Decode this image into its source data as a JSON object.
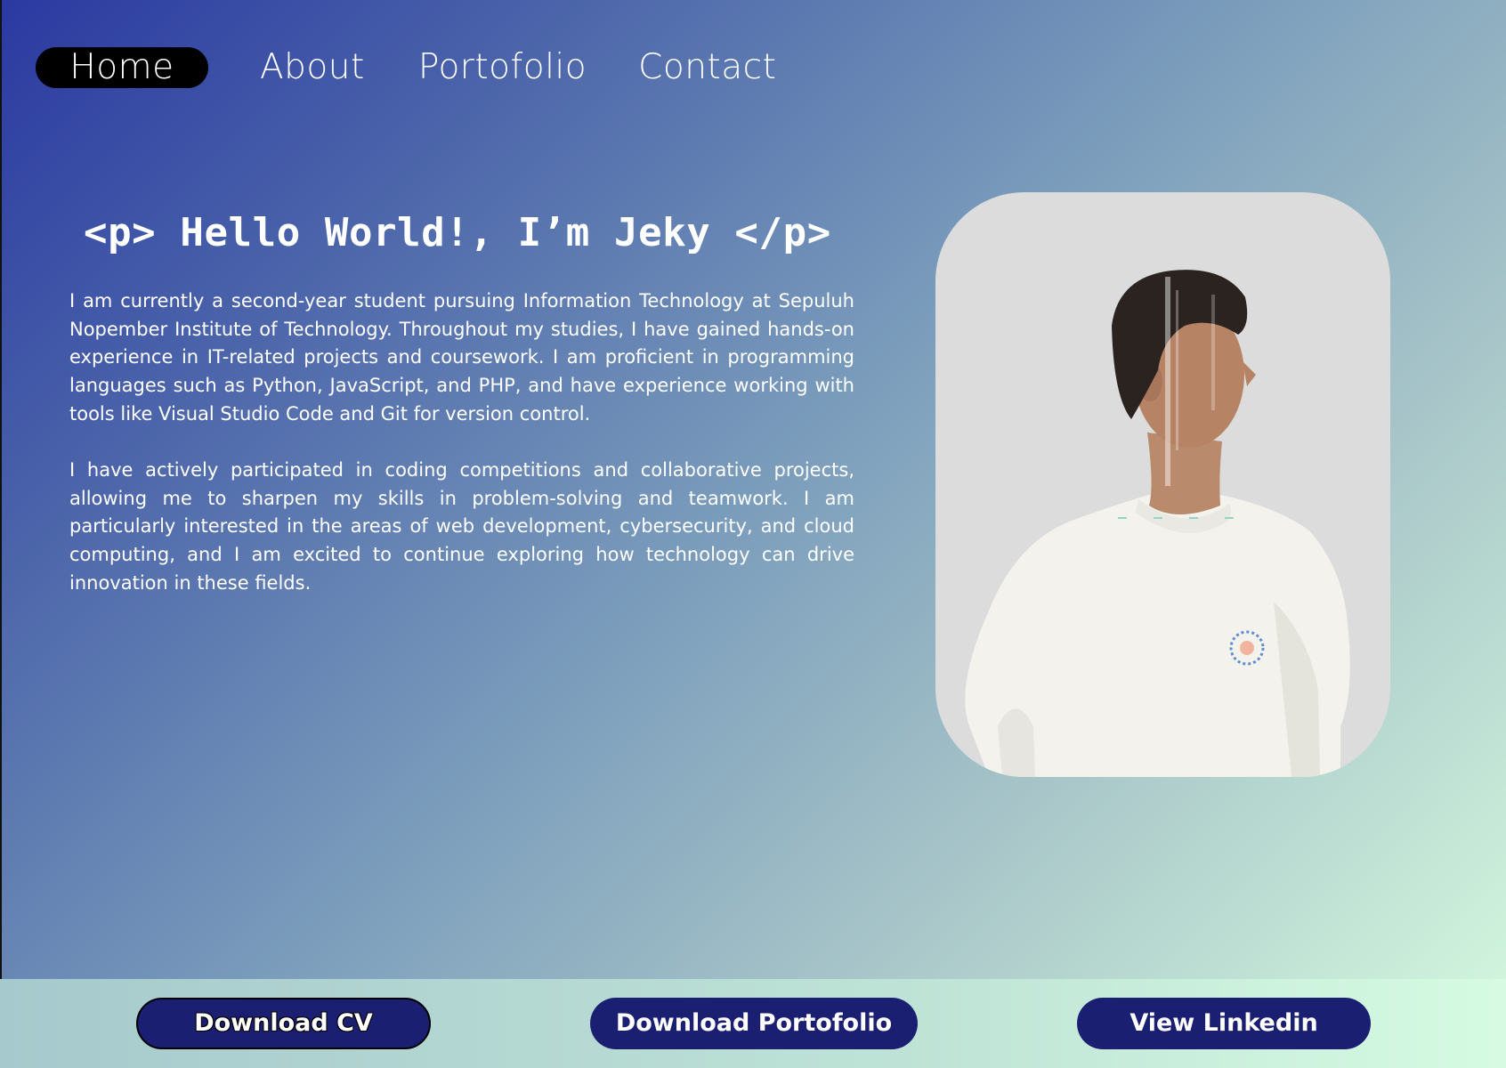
{
  "nav": {
    "items": [
      {
        "label": "Home",
        "active": true
      },
      {
        "label": "About",
        "active": false
      },
      {
        "label": "Portofolio",
        "active": false
      },
      {
        "label": "Contact",
        "active": false
      }
    ]
  },
  "hero": {
    "title": "<p> Hello World!, I’m Jeky </p>",
    "paragraphs": [
      "I am currently a second-year student pursuing Information Technology at Sepuluh Nopember Institute of Technology. Throughout my studies, I have gained hands-on experience in IT-related projects and coursework. I am proficient in programming languages such as Python, JavaScript, and PHP, and have experience working with tools like Visual Studio Code and Git for version control.",
      "I have actively participated in coding competitions and collaborative projects, allowing me to sharpen my skills in problem-solving and teamwork. I am particularly interested in the areas of web development, cybersecurity, and cloud computing, and I am excited to continue exploring how technology can drive innovation in these fields."
    ]
  },
  "actions": {
    "download_cv": "Download CV",
    "download_portfolio": "Download Portofolio",
    "view_linkedin": "View Linkedin"
  },
  "colors": {
    "gradient_start": "#2a39a1",
    "gradient_end": "#d5fbdf",
    "button_bg": "#1b1f72",
    "nav_active_bg": "#000000",
    "photo_bg": "#dcdcdc"
  }
}
